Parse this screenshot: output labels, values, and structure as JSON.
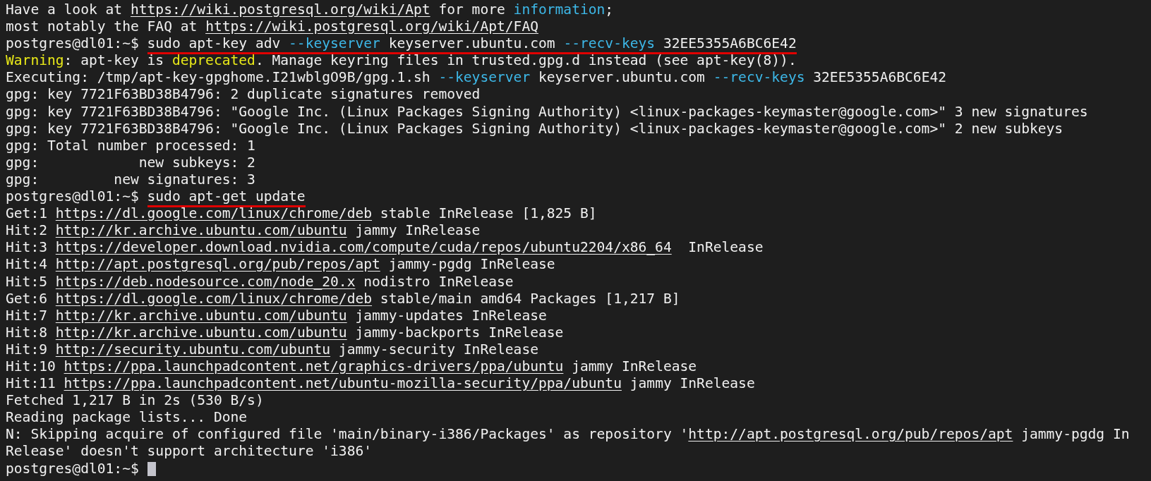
{
  "terminal": {
    "lines": [
      {
        "kind": "output",
        "segments": [
          {
            "kind": "text",
            "text": "Have a look at "
          },
          {
            "kind": "link",
            "text": "https://wiki.postgresql.org/wiki/Apt"
          },
          {
            "kind": "text",
            "text": " for more "
          },
          {
            "kind": "accent",
            "text": "information"
          },
          {
            "kind": "text",
            "text": ";"
          }
        ]
      },
      {
        "kind": "output",
        "segments": [
          {
            "kind": "text",
            "text": "most notably the FAQ at "
          },
          {
            "kind": "link",
            "text": "https://wiki.postgresql.org/wiki/Apt/FAQ"
          }
        ]
      },
      {
        "kind": "prompt",
        "prompt": "postgres@dl01:~$",
        "segments": [
          {
            "kind": "text",
            "text": "sudo apt-key adv "
          },
          {
            "kind": "accent",
            "text": "--keyserver"
          },
          {
            "kind": "text",
            "text": " keyserver.ubuntu.com "
          },
          {
            "kind": "accent",
            "text": "--recv-keys"
          },
          {
            "kind": "text",
            "text": " 32EE5355A6BC6E42"
          }
        ]
      },
      {
        "kind": "output",
        "segments": [
          {
            "kind": "warn",
            "text": "Warning"
          },
          {
            "kind": "text",
            "text": ": apt-key is "
          },
          {
            "kind": "warn",
            "text": "deprecated"
          },
          {
            "kind": "text",
            "text": ". Manage keyring files in trusted.gpg.d instead (see apt-key(8))."
          }
        ]
      },
      {
        "kind": "output",
        "segments": [
          {
            "kind": "text",
            "text": "Executing: /tmp/apt-key-gpghome.I21wblgO9B/gpg.1.sh "
          },
          {
            "kind": "accent",
            "text": "--keyserver"
          },
          {
            "kind": "text",
            "text": " keyserver.ubuntu.com "
          },
          {
            "kind": "accent",
            "text": "--recv-keys"
          },
          {
            "kind": "text",
            "text": " 32EE5355A6BC6E42"
          }
        ]
      },
      {
        "kind": "output",
        "segments": [
          {
            "kind": "text",
            "text": "gpg: key 7721F63BD38B4796: 2 duplicate signatures removed"
          }
        ]
      },
      {
        "kind": "output",
        "segments": [
          {
            "kind": "text",
            "text": "gpg: key 7721F63BD38B4796: \"Google Inc. (Linux Packages Signing Authority) <linux-packages-keymaster@google.com>\" 3 new signatures"
          }
        ]
      },
      {
        "kind": "output",
        "segments": [
          {
            "kind": "text",
            "text": "gpg: key 7721F63BD38B4796: \"Google Inc. (Linux Packages Signing Authority) <linux-packages-keymaster@google.com>\" 2 new subkeys"
          }
        ]
      },
      {
        "kind": "output",
        "segments": [
          {
            "kind": "text",
            "text": "gpg: Total number processed: 1"
          }
        ]
      },
      {
        "kind": "output",
        "segments": [
          {
            "kind": "text",
            "text": "gpg:            new subkeys: 2"
          }
        ]
      },
      {
        "kind": "output",
        "segments": [
          {
            "kind": "text",
            "text": "gpg:         new signatures: 3"
          }
        ]
      },
      {
        "kind": "prompt",
        "prompt": "postgres@dl01:~$",
        "segments": [
          {
            "kind": "text",
            "text": "sudo apt-get update"
          }
        ]
      },
      {
        "kind": "output",
        "segments": [
          {
            "kind": "text",
            "text": "Get:1 "
          },
          {
            "kind": "link",
            "text": "https://dl.google.com/linux/chrome/deb"
          },
          {
            "kind": "text",
            "text": " stable InRelease [1,825 B]"
          }
        ]
      },
      {
        "kind": "output",
        "segments": [
          {
            "kind": "text",
            "text": "Hit:2 "
          },
          {
            "kind": "link",
            "text": "http://kr.archive.ubuntu.com/ubuntu"
          },
          {
            "kind": "text",
            "text": " jammy InRelease"
          }
        ]
      },
      {
        "kind": "output",
        "segments": [
          {
            "kind": "text",
            "text": "Hit:3 "
          },
          {
            "kind": "link",
            "text": "https://developer.download.nvidia.com/compute/cuda/repos/ubuntu2204/x86_64"
          },
          {
            "kind": "text",
            "text": "  InRelease"
          }
        ]
      },
      {
        "kind": "output",
        "segments": [
          {
            "kind": "text",
            "text": "Hit:4 "
          },
          {
            "kind": "link",
            "text": "http://apt.postgresql.org/pub/repos/apt"
          },
          {
            "kind": "text",
            "text": " jammy-pgdg InRelease"
          }
        ]
      },
      {
        "kind": "output",
        "segments": [
          {
            "kind": "text",
            "text": "Hit:5 "
          },
          {
            "kind": "link",
            "text": "https://deb.nodesource.com/node_20.x"
          },
          {
            "kind": "text",
            "text": " nodistro InRelease"
          }
        ]
      },
      {
        "kind": "output",
        "segments": [
          {
            "kind": "text",
            "text": "Get:6 "
          },
          {
            "kind": "link",
            "text": "https://dl.google.com/linux/chrome/deb"
          },
          {
            "kind": "text",
            "text": " stable/main amd64 Packages [1,217 B]"
          }
        ]
      },
      {
        "kind": "output",
        "segments": [
          {
            "kind": "text",
            "text": "Hit:7 "
          },
          {
            "kind": "link",
            "text": "http://kr.archive.ubuntu.com/ubuntu"
          },
          {
            "kind": "text",
            "text": " jammy-updates InRelease"
          }
        ]
      },
      {
        "kind": "output",
        "segments": [
          {
            "kind": "text",
            "text": "Hit:8 "
          },
          {
            "kind": "link",
            "text": "http://kr.archive.ubuntu.com/ubuntu"
          },
          {
            "kind": "text",
            "text": " jammy-backports InRelease"
          }
        ]
      },
      {
        "kind": "output",
        "segments": [
          {
            "kind": "text",
            "text": "Hit:9 "
          },
          {
            "kind": "link",
            "text": "http://security.ubuntu.com/ubuntu"
          },
          {
            "kind": "text",
            "text": " jammy-security InRelease"
          }
        ]
      },
      {
        "kind": "output",
        "segments": [
          {
            "kind": "text",
            "text": "Hit:10 "
          },
          {
            "kind": "link",
            "text": "https://ppa.launchpadcontent.net/graphics-drivers/ppa/ubuntu"
          },
          {
            "kind": "text",
            "text": " jammy InRelease"
          }
        ]
      },
      {
        "kind": "output",
        "segments": [
          {
            "kind": "text",
            "text": "Hit:11 "
          },
          {
            "kind": "link",
            "text": "https://ppa.launchpadcontent.net/ubuntu-mozilla-security/ppa/ubuntu"
          },
          {
            "kind": "text",
            "text": " jammy InRelease"
          }
        ]
      },
      {
        "kind": "output",
        "segments": [
          {
            "kind": "text",
            "text": "Fetched 1,217 B in 2s (530 B/s)"
          }
        ]
      },
      {
        "kind": "output",
        "segments": [
          {
            "kind": "text",
            "text": "Reading package lists... Done"
          }
        ]
      },
      {
        "kind": "output",
        "segments": [
          {
            "kind": "text",
            "text": "N: Skipping acquire of configured file 'main/binary-i386/Packages' as repository '"
          },
          {
            "kind": "link",
            "text": "http://apt.postgresql.org/pub/repos/apt"
          },
          {
            "kind": "text",
            "text": " jammy-pgdg In"
          }
        ]
      },
      {
        "kind": "output",
        "segments": [
          {
            "kind": "text",
            "text": "Release' doesn't support architecture 'i386'"
          }
        ]
      },
      {
        "kind": "input",
        "prompt": "postgres@dl01:~$"
      }
    ]
  }
}
